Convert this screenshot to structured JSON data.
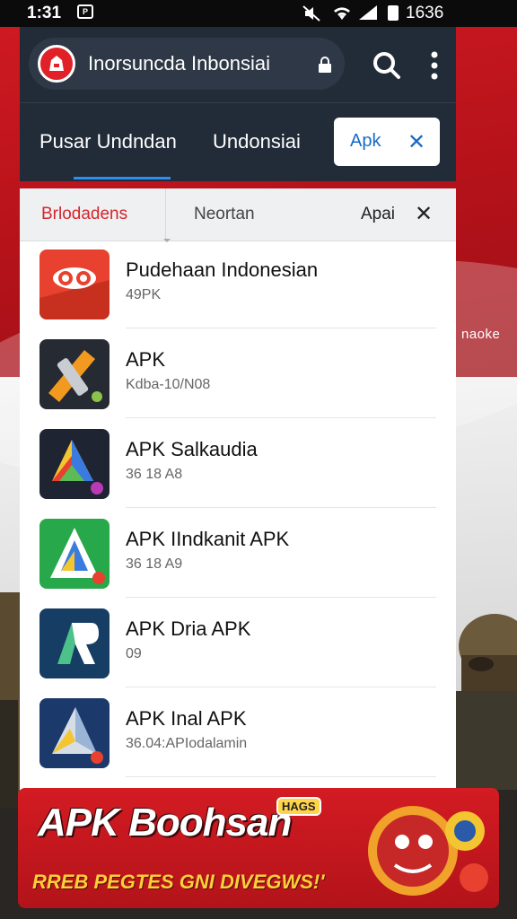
{
  "status_bar": {
    "time": "1:31",
    "battery_text": "1636"
  },
  "header": {
    "url_text": "Inorsuncda Inbonsiai",
    "tabs": [
      {
        "label": "Pusar Undndan",
        "active": true
      },
      {
        "label": "Undonsiai",
        "active": false
      }
    ],
    "chip": {
      "label": "Apk"
    }
  },
  "filters": [
    {
      "label": "Brlodadens",
      "active": true
    },
    {
      "label": "Neortan",
      "active": false
    },
    {
      "label": "Apai",
      "active": false
    }
  ],
  "apps": [
    {
      "title": "Pudehaan Indonesian",
      "subtitle": "49PK",
      "icon": "infinity-app-icon",
      "color": "#e8412f"
    },
    {
      "title": "APK",
      "subtitle": "Kdba-10/N08",
      "icon": "tools-app-icon",
      "color": "#262a33"
    },
    {
      "title": "APK Salkaudia",
      "subtitle": "36 18 A8",
      "icon": "triangle-app-icon",
      "color": "#1f2433"
    },
    {
      "title": "APK IIndkanit APK",
      "subtitle": "36 18 A9",
      "icon": "a-letter-app-icon",
      "color": "#27a84a"
    },
    {
      "title": "APK Dria APK",
      "subtitle": "09",
      "icon": "ar-app-icon",
      "color": "#163d63"
    },
    {
      "title": "APK Inal APK",
      "subtitle": "36.04:APIodalamin",
      "icon": "paper-triangle-app-icon",
      "color": "#1b3a6b"
    }
  ],
  "side_text": "naoke",
  "promo": {
    "title": "APK Boohsan",
    "subtitle": "RREB PEGTES GNI DIVEGWS!'",
    "badge": "HAGS"
  },
  "colors": {
    "header_bg": "#222b38",
    "accent_blue": "#1769c7",
    "accent_red": "#d3262c"
  }
}
